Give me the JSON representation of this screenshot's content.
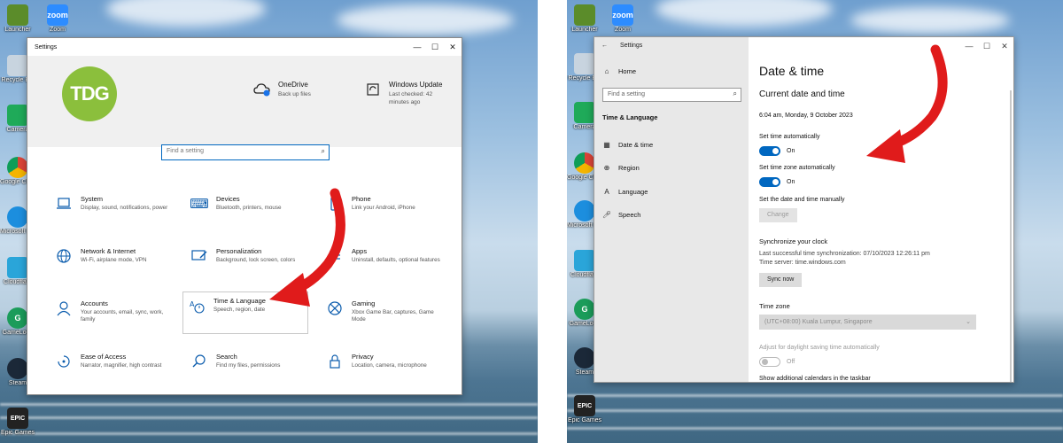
{
  "desktop_icons": [
    {
      "label": "Launcher",
      "color": "#5b8c2a"
    },
    {
      "label": "Zoom",
      "color": "#2d8cff",
      "glyph": "zoom"
    },
    {
      "label": "Recycle Bin",
      "color": "#c8d4df"
    },
    {
      "label": "Camera",
      "color": "#1faa59"
    },
    {
      "label": "Google Chrome",
      "color": "#ffffff"
    },
    {
      "label": "Microsoft Edge",
      "color": "#1c8ede"
    },
    {
      "label": "Cloudflare",
      "color": "#2aa5d9"
    },
    {
      "label": "GameLoop",
      "color": "#1b9c5a"
    },
    {
      "label": "Steam",
      "color": "#1b2838"
    },
    {
      "label": "Epic Games",
      "color": "#222222",
      "glyph": "EPIC"
    }
  ],
  "left_window": {
    "title": "Settings",
    "controls": [
      "—",
      "☐",
      "✕"
    ],
    "logo_text": "TDG",
    "hero": [
      {
        "icon": "onedrive-icon",
        "title": "OneDrive",
        "subtitle": "Back up files"
      },
      {
        "icon": "windows-update-icon",
        "title": "Windows Update",
        "subtitle": "Last checked: 42",
        "subtitle2": "minutes ago"
      }
    ],
    "search_placeholder": "Find a setting",
    "categories": [
      {
        "icon": "laptop-icon",
        "title": "System",
        "desc": "Display, sound, notifications, power"
      },
      {
        "icon": "devices-icon",
        "title": "Devices",
        "desc": "Bluetooth, printers, mouse"
      },
      {
        "icon": "phone-icon",
        "title": "Phone",
        "desc": "Link your Android, iPhone"
      },
      {
        "icon": "globe-icon",
        "title": "Network & Internet",
        "desc": "Wi-Fi, airplane mode, VPN"
      },
      {
        "icon": "personalization-icon",
        "title": "Personalization",
        "desc": "Background, lock screen, colors"
      },
      {
        "icon": "apps-icon",
        "title": "Apps",
        "desc": "Uninstall, defaults, optional features"
      },
      {
        "icon": "person-icon",
        "title": "Accounts",
        "desc": "Your accounts, email, sync, work, family"
      },
      {
        "icon": "time-language-icon",
        "title": "Time & Language",
        "desc": "Speech, region, date"
      },
      {
        "icon": "xbox-icon",
        "title": "Gaming",
        "desc": "Xbox Game Bar, captures, Game Mode"
      },
      {
        "icon": "ease-of-access-icon",
        "title": "Ease of Access",
        "desc": "Narrator, magnifier, high contrast"
      },
      {
        "icon": "search-icon",
        "title": "Search",
        "desc": "Find my files, permissions"
      },
      {
        "icon": "lock-icon",
        "title": "Privacy",
        "desc": "Location, camera, microphone"
      }
    ]
  },
  "right_window": {
    "title": "Settings",
    "back": "←",
    "home_label": "Home",
    "search_placeholder": "Find a setting",
    "section_label": "Time & Language",
    "nav_items": [
      {
        "icon": "calendar-clock-icon",
        "label": "Date & time"
      },
      {
        "icon": "region-icon",
        "label": "Region"
      },
      {
        "icon": "language-icon",
        "label": "Language"
      },
      {
        "icon": "microphone-icon",
        "label": "Speech"
      }
    ],
    "page_title": "Date & time",
    "subheading": "Current date and time",
    "current_datetime": "6:04 am, Monday, 9 October 2023",
    "set_time_auto_label": "Set time automatically",
    "set_time_auto_state": "On",
    "set_zone_auto_label": "Set time zone automatically",
    "set_zone_auto_state": "On",
    "manual_label": "Set the date and time manually",
    "change_button": "Change",
    "sync_heading": "Synchronize your clock",
    "sync_last": "Last successful time synchronization: 07/10/2023 12:26:11 pm",
    "sync_server": "Time server: time.windows.com",
    "sync_button": "Sync now",
    "timezone_label": "Time zone",
    "timezone_value": "(UTC+08:00) Kuala Lumpur, Singapore",
    "dst_label": "Adjust for daylight saving time automatically",
    "dst_state": "Off",
    "calendars_label": "Show additional calendars in the taskbar"
  },
  "colors": {
    "accent": "#0067c0",
    "arrow": "#e01b1b",
    "logo": "#8bbf3c"
  }
}
